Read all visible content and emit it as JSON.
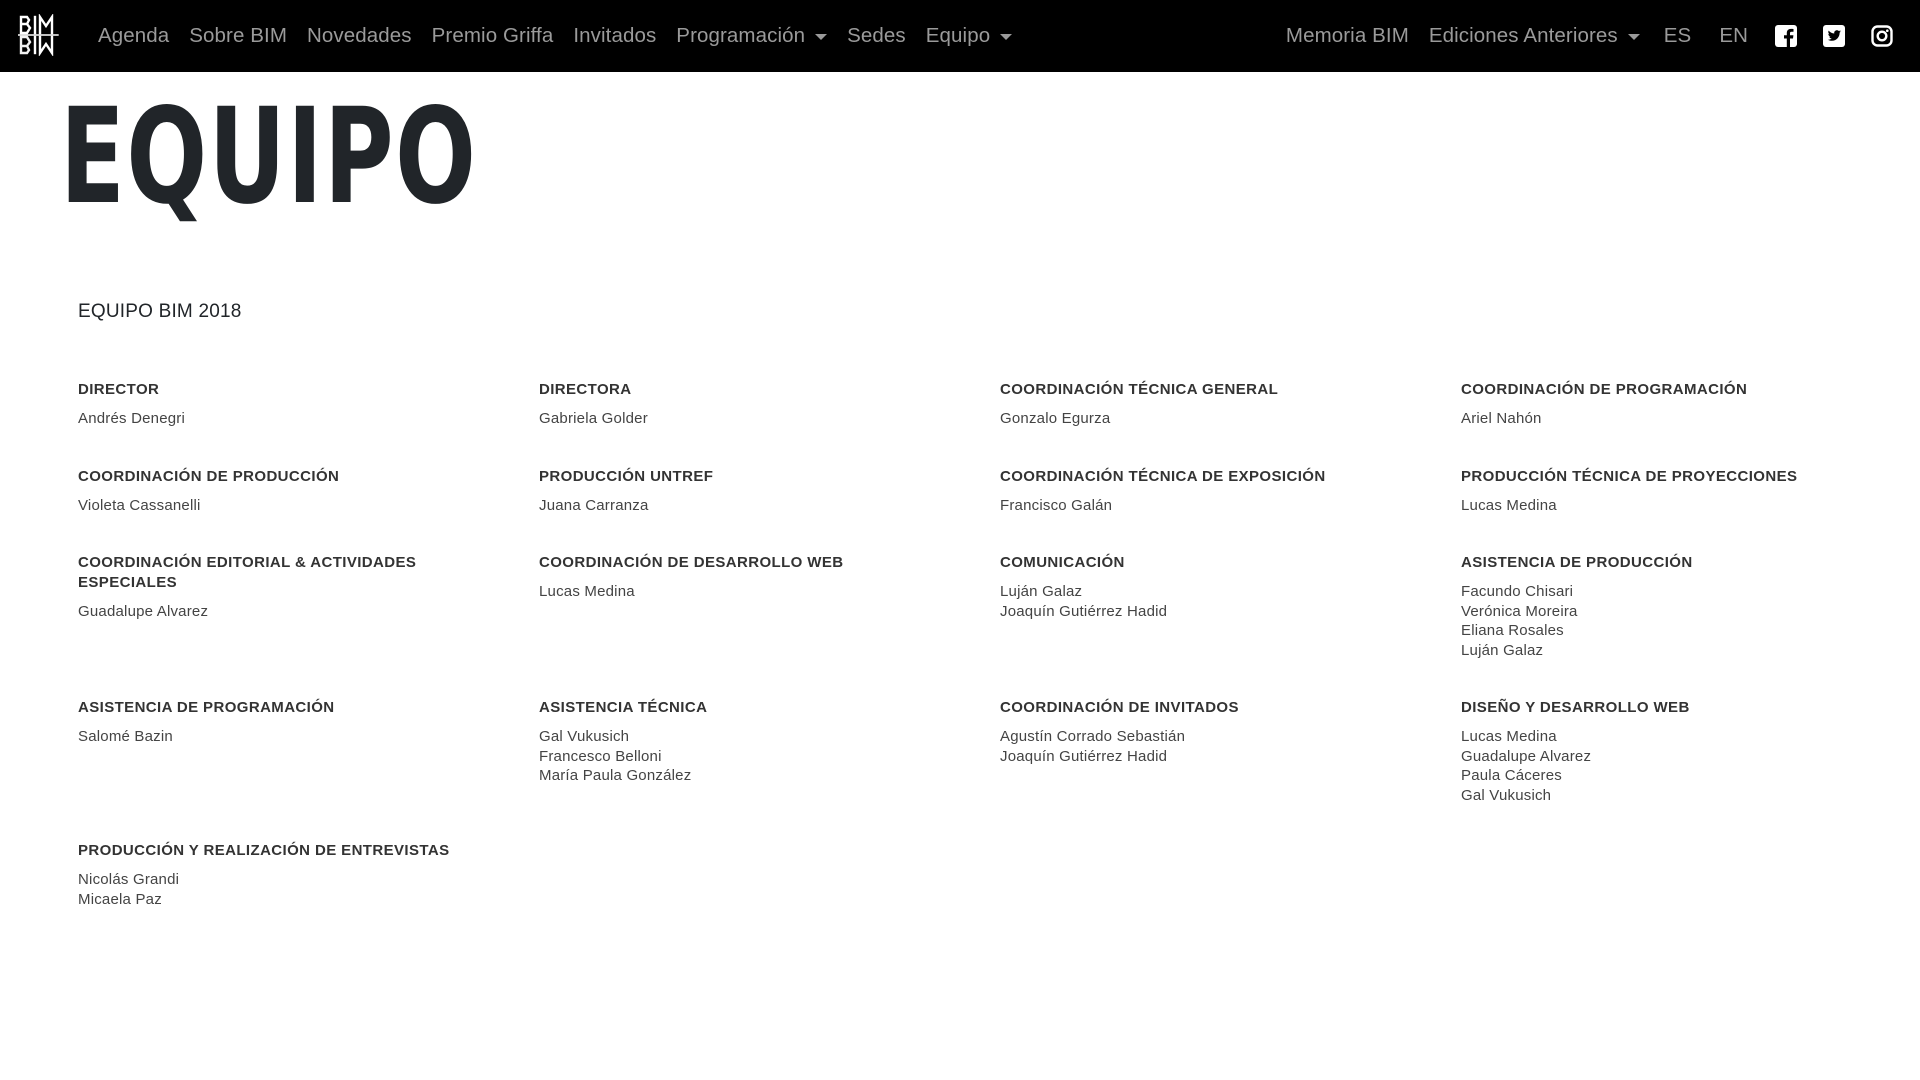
{
  "nav": {
    "left": [
      {
        "label": "Agenda",
        "dropdown": false
      },
      {
        "label": "Sobre BIM",
        "dropdown": false
      },
      {
        "label": "Novedades",
        "dropdown": false
      },
      {
        "label": "Premio Griffa",
        "dropdown": false
      },
      {
        "label": "Invitados",
        "dropdown": false
      },
      {
        "label": "Programación",
        "dropdown": true
      },
      {
        "label": "Sedes",
        "dropdown": false
      },
      {
        "label": "Equipo",
        "dropdown": true
      }
    ],
    "right": {
      "memoria": "Memoria BIM",
      "ediciones": "Ediciones Anteriores",
      "lang_es": "ES",
      "lang_en": "EN"
    },
    "icons": {
      "logo": "bim-logo",
      "facebook": "facebook-icon",
      "twitter": "twitter-icon",
      "instagram": "instagram-icon"
    },
    "colors": {
      "background": "#000000",
      "link": "#9a9a9a"
    }
  },
  "page": {
    "title": "EQUIPO",
    "section_heading": "EQUIPO BIM 2018"
  },
  "team": [
    {
      "role": "DIRECTOR",
      "people": [
        "Andrés Denegri"
      ]
    },
    {
      "role": "DIRECTORA",
      "people": [
        "Gabriela Golder"
      ]
    },
    {
      "role": "COORDINACIÓN TÉCNICA GENERAL",
      "people": [
        "Gonzalo Egurza"
      ]
    },
    {
      "role": "COORDINACIÓN DE PROGRAMACIÓN",
      "people": [
        "Ariel Nahón"
      ]
    },
    {
      "role": "COORDINACIÓN DE PRODUCCIÓN",
      "people": [
        "Violeta Cassanelli"
      ]
    },
    {
      "role": "PRODUCCIÓN UNTREF",
      "people": [
        "Juana Carranza"
      ]
    },
    {
      "role": "COORDINACIÓN TÉCNICA DE EXPOSICIÓN",
      "people": [
        "Francisco Galán"
      ]
    },
    {
      "role": "PRODUCCIÓN TÉCNICA DE PROYECCIONES",
      "people": [
        "Lucas Medina"
      ]
    },
    {
      "role": "COORDINACIÓN EDITORIAL & ACTIVIDADES ESPECIALES",
      "people": [
        "Guadalupe Alvarez"
      ]
    },
    {
      "role": "COORDINACIÓN DE DESARROLLO WEB",
      "people": [
        "Lucas Medina"
      ]
    },
    {
      "role": "COMUNICACIÓN",
      "people": [
        "Luján Galaz",
        "Joaquín Gutiérrez Hadid"
      ]
    },
    {
      "role": "ASISTENCIA DE PRODUCCIÓN",
      "people": [
        "Facundo Chisari",
        "Verónica Moreira",
        "Eliana Rosales",
        "Luján Galaz"
      ]
    },
    {
      "role": "ASISTENCIA DE PROGRAMACIÓN",
      "people": [
        "Salomé Bazin"
      ]
    },
    {
      "role": "ASISTENCIA TÉCNICA",
      "people": [
        "Gal Vukusich",
        "Francesco Belloni",
        "María Paula González"
      ]
    },
    {
      "role": "COORDINACIÓN DE INVITADOS",
      "people": [
        "Agustín Corrado Sebastián",
        "Joaquín Gutiérrez Hadid"
      ]
    },
    {
      "role": "DISEÑO Y DESARROLLO WEB",
      "people": [
        "Lucas Medina",
        "Guadalupe Alvarez",
        "Paula Cáceres",
        "Gal Vukusich"
      ]
    },
    {
      "role": "PRODUCCIÓN Y REALIZACIÓN DE ENTREVISTAS",
      "people": [
        "Nicolás Grandi",
        "Micaela Paz"
      ]
    }
  ]
}
